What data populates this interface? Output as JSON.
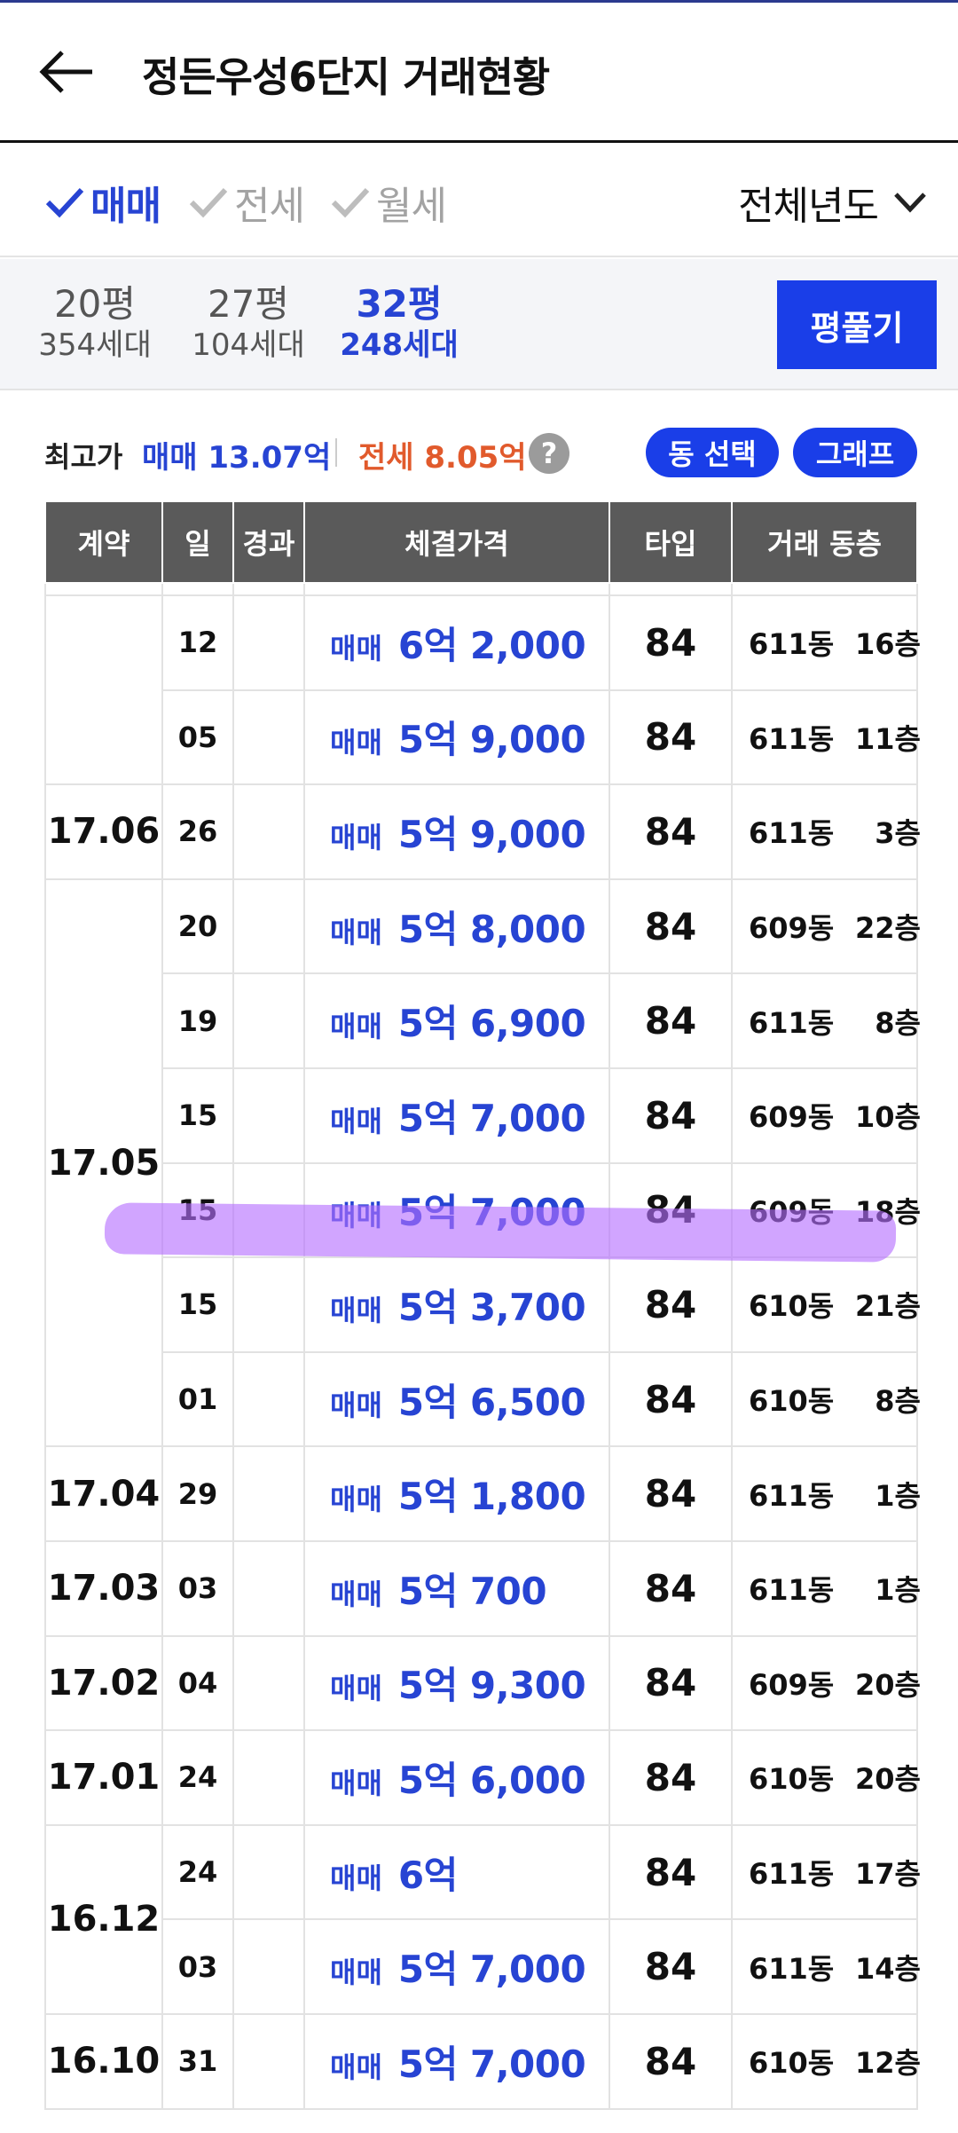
{
  "header": {
    "title": "정든우성6단지 거래현황",
    "back_icon": "arrow-left-icon"
  },
  "filters": {
    "sale": {
      "label": "매매",
      "checked": true
    },
    "jeonse": {
      "label": "전세",
      "checked": false
    },
    "monthly": {
      "label": "월세",
      "checked": false
    },
    "year_select": "전체년도"
  },
  "sizes": {
    "tabs": [
      {
        "pyeong": "20평",
        "households": "354세대",
        "active": false
      },
      {
        "pyeong": "27평",
        "households": "104세대",
        "active": false
      },
      {
        "pyeong": "32평",
        "households": "248세대",
        "active": true
      }
    ],
    "expand_button": "평풀기"
  },
  "summary": {
    "label": "최고가",
    "sale": "매매 13.07억",
    "jeonse": "전세 8.05억",
    "help": "?",
    "dong_button": "동 선택",
    "graph_button": "그래프"
  },
  "table": {
    "headers": [
      "계약",
      "일",
      "경과",
      "체결가격",
      "타입",
      "거래 동층"
    ],
    "groups": [
      {
        "month": "",
        "rows": [
          {
            "day": "12",
            "kind": "매매",
            "price": "6억 2,000",
            "type": "84",
            "dong": "611동",
            "floor": "16층"
          },
          {
            "day": "05",
            "kind": "매매",
            "price": "5억 9,000",
            "type": "84",
            "dong": "611동",
            "floor": "11층"
          }
        ]
      },
      {
        "month": "17.06",
        "rows": [
          {
            "day": "26",
            "kind": "매매",
            "price": "5억 9,000",
            "type": "84",
            "dong": "611동",
            "floor": "3층"
          }
        ]
      },
      {
        "month": "17.05",
        "rows": [
          {
            "day": "20",
            "kind": "매매",
            "price": "5억 8,000",
            "type": "84",
            "dong": "609동",
            "floor": "22층"
          },
          {
            "day": "19",
            "kind": "매매",
            "price": "5억 6,900",
            "type": "84",
            "dong": "611동",
            "floor": "8층"
          },
          {
            "day": "15",
            "kind": "매매",
            "price": "5억 7,000",
            "type": "84",
            "dong": "609동",
            "floor": "10층"
          },
          {
            "day": "15",
            "kind": "매매",
            "price": "5억 7,000",
            "type": "84",
            "dong": "609동",
            "floor": "18층"
          },
          {
            "day": "15",
            "kind": "매매",
            "price": "5억 3,700",
            "type": "84",
            "dong": "610동",
            "floor": "21층"
          },
          {
            "day": "01",
            "kind": "매매",
            "price": "5억 6,500",
            "type": "84",
            "dong": "610동",
            "floor": "8층"
          }
        ]
      },
      {
        "month": "17.04",
        "rows": [
          {
            "day": "29",
            "kind": "매매",
            "price": "5억 1,800",
            "type": "84",
            "dong": "611동",
            "floor": "1층"
          }
        ]
      },
      {
        "month": "17.03",
        "rows": [
          {
            "day": "03",
            "kind": "매매",
            "price": "5억 700",
            "type": "84",
            "dong": "611동",
            "floor": "1층"
          }
        ]
      },
      {
        "month": "17.02",
        "rows": [
          {
            "day": "04",
            "kind": "매매",
            "price": "5억 9,300",
            "type": "84",
            "dong": "609동",
            "floor": "20층"
          }
        ]
      },
      {
        "month": "17.01",
        "rows": [
          {
            "day": "24",
            "kind": "매매",
            "price": "5억 6,000",
            "type": "84",
            "dong": "610동",
            "floor": "20층"
          }
        ]
      },
      {
        "month": "16.12",
        "rows": [
          {
            "day": "24",
            "kind": "매매",
            "price": "6억",
            "type": "84",
            "dong": "611동",
            "floor": "17층"
          },
          {
            "day": "03",
            "kind": "매매",
            "price": "5억 7,000",
            "type": "84",
            "dong": "611동",
            "floor": "14층"
          }
        ]
      },
      {
        "month": "16.10",
        "rows": [
          {
            "day": "31",
            "kind": "매매",
            "price": "5억 7,000",
            "type": "84",
            "dong": "610동",
            "floor": "12층"
          }
        ]
      }
    ]
  },
  "colors": {
    "accent": "#2744d3",
    "button": "#1a3ee8",
    "jeonse": "#e15a2c",
    "header_bg": "#5a5a5a",
    "highlight": "#b46eff"
  }
}
